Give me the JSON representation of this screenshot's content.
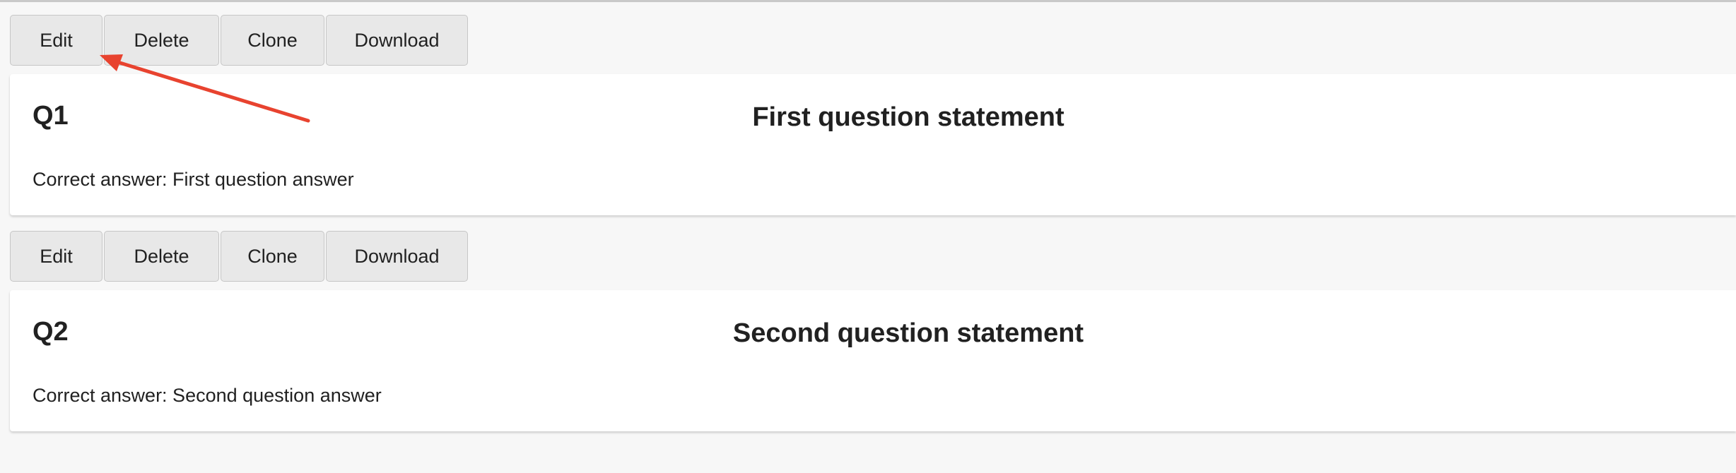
{
  "questions": [
    {
      "toolbar": {
        "edit_label": "Edit",
        "delete_label": "Delete",
        "clone_label": "Clone",
        "download_label": "Download"
      },
      "number": "Q1",
      "statement": "First question statement",
      "answer": "Correct answer: First question answer"
    },
    {
      "toolbar": {
        "edit_label": "Edit",
        "delete_label": "Delete",
        "clone_label": "Clone",
        "download_label": "Download"
      },
      "number": "Q2",
      "statement": "Second question statement",
      "answer": "Correct answer: Second question answer"
    }
  ],
  "annotation": {
    "icon": "red-arrow",
    "color": "#e8432f"
  },
  "colors": {
    "background": "#f7f7f7",
    "card": "#ffffff",
    "button": "#e8e8e8",
    "text": "#212121"
  }
}
